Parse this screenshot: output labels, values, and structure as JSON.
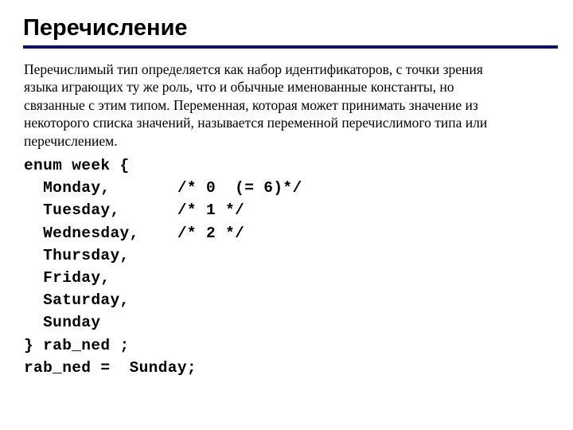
{
  "slide": {
    "title": "Перечисление",
    "rule_color": "#10106b",
    "background_color": "#ffffff",
    "text_color": "#000000"
  },
  "body": {
    "paragraph": "Перечислимый тип определяется как набор идентификаторов, с точки зрения языка играющих ту же роль, что и обычные именованные константы, но связанные с этим типом. Переменная, которая может принимать значение из некоторого списка значений, называется переменной перечислимого типа или перечислением."
  },
  "code": {
    "language": "c",
    "lines": [
      "enum week {",
      "  Monday,       /* 0  (= 6)*/",
      "  Tuesday,      /* 1 */",
      "  Wednesday,    /* 2 */",
      "  Thursday,",
      "  Friday,",
      "  Saturday,",
      "  Sunday",
      "} rab_ned ;",
      "rab_ned =  Sunday;"
    ],
    "enum_name": "week",
    "variable_name": "rab_ned",
    "members": [
      {
        "name": "Monday",
        "comment": "/* 0  (= 6)*/"
      },
      {
        "name": "Tuesday",
        "comment": "/* 1 */"
      },
      {
        "name": "Wednesday",
        "comment": "/* 2 */"
      },
      {
        "name": "Thursday",
        "comment": ""
      },
      {
        "name": "Friday",
        "comment": ""
      },
      {
        "name": "Saturday",
        "comment": ""
      },
      {
        "name": "Sunday",
        "comment": ""
      }
    ],
    "assignment": "rab_ned =  Sunday;"
  }
}
